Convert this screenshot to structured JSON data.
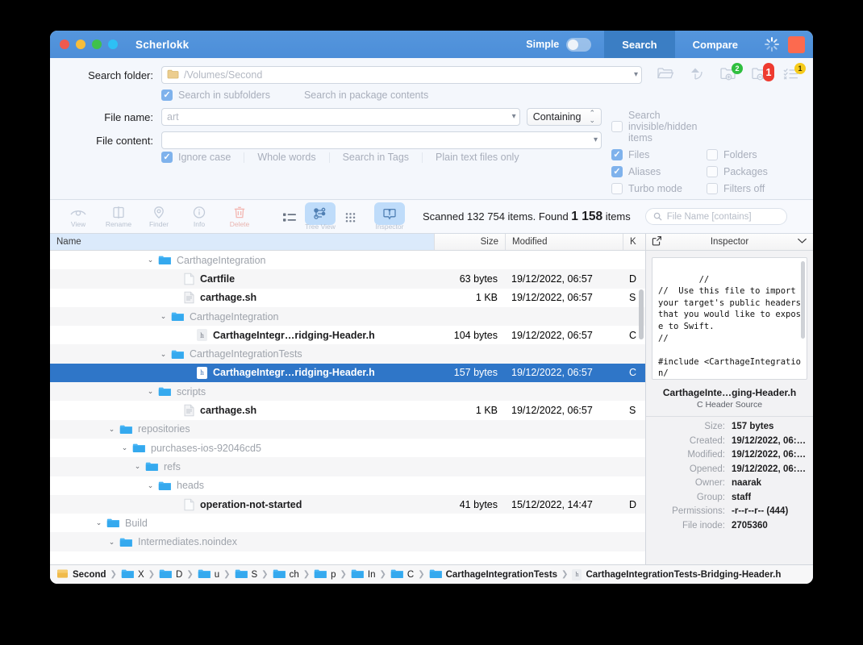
{
  "window": {
    "title": "Scherlokk",
    "traffic": [
      "close",
      "minimize",
      "zoom",
      "extra"
    ]
  },
  "titlebar": {
    "simple_label": "Simple",
    "tab_search": "Search",
    "tab_compare": "Compare",
    "spinner": "activity-spinner",
    "stop": "stop-button"
  },
  "form": {
    "search_folder_label": "Search folder:",
    "search_folder_value": "/Volumes/Second",
    "search_subfolders": "Search in subfolders",
    "search_package_contents": "Search in package contents",
    "file_name_label": "File name:",
    "file_name_value": "art",
    "match_mode": "Containing",
    "file_content_label": "File content:",
    "file_content_value": "",
    "ignore_case": "Ignore case",
    "whole_words": "Whole words",
    "search_in_tags": "Search in Tags",
    "plain_text_only": "Plain text files only",
    "search_invisible": "Search invisible/hidden items",
    "files": "Files",
    "folders": "Folders",
    "aliases": "Aliases",
    "packages": "Packages",
    "turbo_mode": "Turbo mode",
    "filters_off": "Filters off",
    "toolbar": [
      {
        "name": "open-folder-icon",
        "badge": ""
      },
      {
        "name": "revert-arrow-icon",
        "badge": ""
      },
      {
        "name": "add-folder-icon",
        "badge": "2",
        "badge_color": "green"
      },
      {
        "name": "remove-folder-icon",
        "badge": "1",
        "badge_color": "red"
      },
      {
        "name": "filter-list-icon",
        "badge": "1",
        "badge_color": "yellow"
      }
    ]
  },
  "actionbar": {
    "actions": [
      {
        "icon": "eye-icon",
        "label": "View"
      },
      {
        "icon": "rename-icon",
        "label": "Rename"
      },
      {
        "icon": "finder-pin-icon",
        "label": "Finder"
      },
      {
        "icon": "info-icon",
        "label": "Info"
      },
      {
        "icon": "trash-icon",
        "label": "Delete"
      }
    ],
    "viewmodes": [
      {
        "icon": "list-view-icon",
        "label": "",
        "selected": false
      },
      {
        "icon": "tree-view-icon",
        "label": "Tree View",
        "selected": true
      },
      {
        "icon": "grid-view-icon",
        "label": "",
        "selected": false
      },
      {
        "icon": "inspector-icon",
        "label": "Inspector",
        "selected": true
      }
    ],
    "scanned_prefix": "Scanned 132 754 items. Found ",
    "found_count": "1 158",
    "scanned_suffix": " items",
    "filter_placeholder": "File Name [contains]"
  },
  "list": {
    "columns": [
      "Name",
      "Size",
      "Modified",
      "K"
    ],
    "rows": [
      {
        "indent": 7,
        "disc": "⌄",
        "icon": "folder",
        "name": "CarthageIntegration",
        "kind": "folder",
        "size": "",
        "modified": "",
        "k": ""
      },
      {
        "indent": 9,
        "disc": "",
        "icon": "doc",
        "name": "Cartfile",
        "kind": "file",
        "size": "63 bytes",
        "modified": "19/12/2022, 06:57",
        "k": "D"
      },
      {
        "indent": 9,
        "disc": "",
        "icon": "script",
        "name": "carthage.sh",
        "kind": "file",
        "size": "1 KB",
        "modified": "19/12/2022, 06:57",
        "k": "S"
      },
      {
        "indent": 8,
        "disc": "⌄",
        "icon": "folder",
        "name": "CarthageIntegration",
        "kind": "folder",
        "size": "",
        "modified": "",
        "k": ""
      },
      {
        "indent": 10,
        "disc": "",
        "icon": "h",
        "name": "CarthageIntegr…ridging-Header.h",
        "kind": "file",
        "size": "104 bytes",
        "modified": "19/12/2022, 06:57",
        "k": "C"
      },
      {
        "indent": 8,
        "disc": "⌄",
        "icon": "folder",
        "name": "CarthageIntegrationTests",
        "kind": "folder",
        "size": "",
        "modified": "",
        "k": ""
      },
      {
        "indent": 10,
        "disc": "",
        "icon": "h",
        "name": "CarthageIntegr…ridging-Header.h",
        "kind": "file",
        "size": "157 bytes",
        "modified": "19/12/2022, 06:57",
        "k": "C",
        "selected": true
      },
      {
        "indent": 7,
        "disc": "⌄",
        "icon": "folder",
        "name": "scripts",
        "kind": "folder",
        "size": "",
        "modified": "",
        "k": ""
      },
      {
        "indent": 9,
        "disc": "",
        "icon": "script",
        "name": "carthage.sh",
        "kind": "file",
        "size": "1 KB",
        "modified": "19/12/2022, 06:57",
        "k": "S"
      },
      {
        "indent": 4,
        "disc": "⌄",
        "icon": "folder",
        "name": "repositories",
        "kind": "folder",
        "size": "",
        "modified": "",
        "k": ""
      },
      {
        "indent": 5,
        "disc": "⌄",
        "icon": "folder",
        "name": "purchases-ios-92046cd5",
        "kind": "folder",
        "size": "",
        "modified": "",
        "k": ""
      },
      {
        "indent": 6,
        "disc": "⌄",
        "icon": "folder",
        "name": "refs",
        "kind": "folder",
        "size": "",
        "modified": "",
        "k": ""
      },
      {
        "indent": 7,
        "disc": "⌄",
        "icon": "folder",
        "name": "heads",
        "kind": "folder",
        "size": "",
        "modified": "",
        "k": ""
      },
      {
        "indent": 9,
        "disc": "",
        "icon": "doc",
        "name": "operation-not-started",
        "kind": "file",
        "size": "41 bytes",
        "modified": "15/12/2022, 14:47",
        "k": "D"
      },
      {
        "indent": 3,
        "disc": "⌄",
        "icon": "folder",
        "name": "Build",
        "kind": "folder",
        "size": "",
        "modified": "",
        "k": ""
      },
      {
        "indent": 4,
        "disc": "⌄",
        "icon": "folder",
        "name": "Intermediates.noindex",
        "kind": "folder",
        "size": "",
        "modified": "",
        "k": ""
      }
    ]
  },
  "inspector": {
    "header_title": "Inspector",
    "open_icon": "open-external-icon",
    "collapse_icon": "chevron-down-icon",
    "preview_text": "//\n//  Use this file to import your target's public headers that you would like to expose to Swift.\n//\n\n#include <CarthageIntegration/",
    "file_name": "CarthageInte…ging-Header.h",
    "file_type": "C Header Source",
    "fields": [
      {
        "label": "Size:",
        "value": "157 bytes"
      },
      {
        "label": "Created:",
        "value": "19/12/2022, 06:…"
      },
      {
        "label": "Modified:",
        "value": "19/12/2022, 06:…"
      },
      {
        "label": "Opened:",
        "value": "19/12/2022, 06:…"
      },
      {
        "label": "Owner:",
        "value": "naarak"
      },
      {
        "label": "Group:",
        "value": "staff"
      },
      {
        "label": "Permissions:",
        "value": "-r--r--r-- (444)"
      },
      {
        "label": "File inode:",
        "value": "2705360"
      }
    ]
  },
  "breadcrumb": [
    {
      "icon": "volume",
      "label": "Second",
      "truncated": false
    },
    {
      "icon": "folder",
      "label": "X",
      "truncated": true
    },
    {
      "icon": "folder",
      "label": "D",
      "truncated": true
    },
    {
      "icon": "folder",
      "label": "u",
      "truncated": true
    },
    {
      "icon": "folder",
      "label": "S",
      "truncated": true
    },
    {
      "icon": "folder",
      "label": "ch",
      "truncated": true
    },
    {
      "icon": "folder",
      "label": "p",
      "truncated": true
    },
    {
      "icon": "folder",
      "label": "In",
      "truncated": true
    },
    {
      "icon": "folder",
      "label": "C",
      "truncated": true
    },
    {
      "icon": "folder",
      "label": "CarthageIntegrationTests",
      "truncated": false
    },
    {
      "icon": "h",
      "label": "CarthageIntegrationTests-Bridging-Header.h",
      "truncated": false
    }
  ],
  "colors": {
    "title_bar": "#4c8ed8",
    "selection": "#2f76c8",
    "accent_badge_green": "#2fbf3f",
    "accent_badge_red": "#ee3b30",
    "accent_badge_yellow": "#f6cb1b",
    "stop_button": "#fc6a4f"
  }
}
